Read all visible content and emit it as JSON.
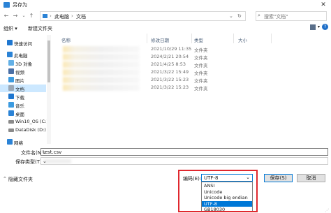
{
  "window": {
    "title": "另存为",
    "close": "✕"
  },
  "address": {
    "path": [
      "此电脑",
      "文档"
    ],
    "search_placeholder": "搜索\"文档\""
  },
  "toolbar": {
    "organize": "组织 ▾",
    "new_folder": "新建文件夹"
  },
  "sidebar": {
    "items": [
      {
        "label": "快速访问",
        "icon": "star-icon"
      },
      {
        "label": "此电脑",
        "icon": "computer-icon"
      },
      {
        "label": "3D 对象",
        "icon": "cube-icon"
      },
      {
        "label": "视频",
        "icon": "video-icon"
      },
      {
        "label": "图片",
        "icon": "picture-icon"
      },
      {
        "label": "文档",
        "icon": "document-icon",
        "selected": true
      },
      {
        "label": "下载",
        "icon": "download-icon"
      },
      {
        "label": "音乐",
        "icon": "music-icon"
      },
      {
        "label": "桌面",
        "icon": "desktop-icon"
      },
      {
        "label": "Win10_OS (C:)",
        "icon": "drive-icon"
      },
      {
        "label": "DataDisk (D:)",
        "icon": "drive-icon"
      },
      {
        "label": "网络",
        "icon": "network-icon"
      }
    ]
  },
  "filelist": {
    "columns": [
      "名称",
      "修改日期",
      "类型",
      "大小"
    ],
    "rows": [
      {
        "date": "2021/10/29 11:35",
        "type": "文件夹"
      },
      {
        "date": "2024/2/21 20:54",
        "type": "文件夹"
      },
      {
        "date": "2021/4/25 8:53",
        "type": "文件夹"
      },
      {
        "date": "2021/3/22 15:49",
        "type": "文件夹"
      },
      {
        "date": "2021/3/22 15:23",
        "type": "文件夹"
      },
      {
        "date": "2021/3/22 15:23",
        "type": "文件夹"
      }
    ]
  },
  "form": {
    "filename_label": "文件名(N):",
    "filename_value": "test.csv",
    "filetype_label": "保存类型(T):"
  },
  "footer": {
    "hide_folders": "隐藏文件夹",
    "encoding_label": "编码(E):",
    "encoding_value": "UTF-8",
    "encoding_options": [
      "ANSI",
      "Unicode",
      "Unicode big endian",
      "UTF-8",
      "GB18030"
    ],
    "encoding_selected_index": 3,
    "save": "保存(S)",
    "cancel": "取消"
  },
  "colors": {
    "accent": "#0078d7",
    "highlight": "#e0282e",
    "selected_nav": "#cce8ff"
  }
}
